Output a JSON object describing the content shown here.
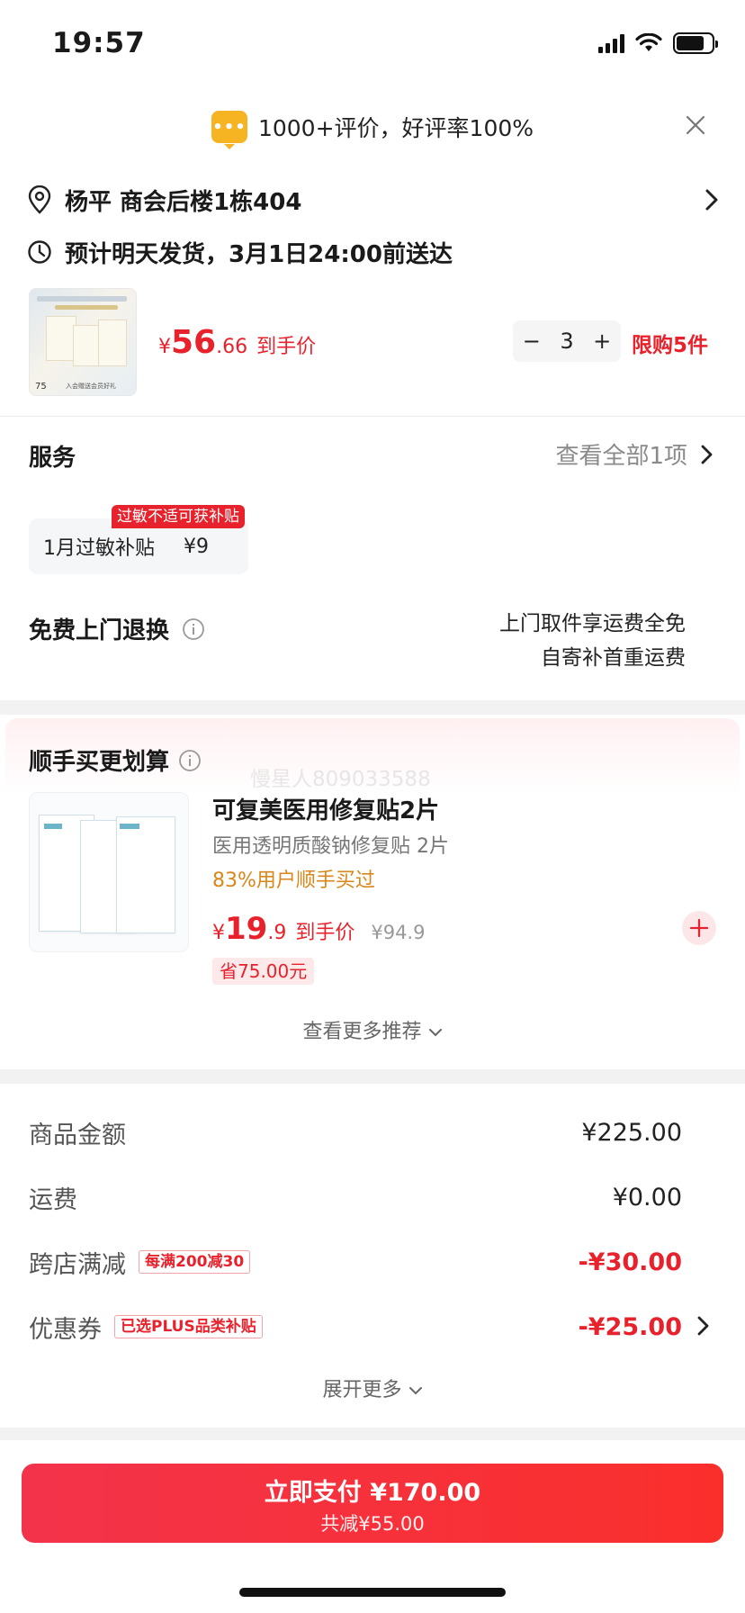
{
  "status_bar": {
    "time": "19:57"
  },
  "review_banner": {
    "icon": "message-bubble-icon",
    "icon_text": "•••",
    "text": "1000+评价，好评率100%"
  },
  "address": {
    "text": "杨平 商会后楼1栋404"
  },
  "delivery": {
    "text": "预计明天发货，3月1日24:00前送达"
  },
  "product": {
    "price_yen": "¥",
    "price_int": "56",
    "price_dec": ".66",
    "price_tag": "到手价",
    "quantity": "3",
    "minus": "−",
    "plus": "+",
    "limit": "限购5件",
    "image_label": "75",
    "image_caption": "入会赠送会员好礼"
  },
  "service": {
    "title": "服务",
    "view_all": "查看全部1项",
    "subsidy_badge": "过敏不适可获补贴",
    "subsidy_label": "1月过敏补贴",
    "subsidy_amount": "¥9",
    "return_title": "免费上门退换",
    "return_desc_line1": "上门取件享运费全免",
    "return_desc_line2": "自寄补首重运费"
  },
  "addon": {
    "title": "顺手买更划算",
    "watermark": "慢星人809033588",
    "name": "可复美医用修复贴2片",
    "desc": "医用透明质酸钠修复贴 2片",
    "pct": "83%用户顺手买过",
    "price_yen": "¥",
    "price_int": "19",
    "price_dec": ".9",
    "price_tag": "到手价",
    "orig_price": "¥94.9",
    "save": "省75.00元",
    "more": "查看更多推荐"
  },
  "amounts": {
    "goods_label": "商品金额",
    "goods_value": "¥225.00",
    "shipping_label": "运费",
    "shipping_value": "¥0.00",
    "cross_label": "跨店满减",
    "cross_chip": "每满200减30",
    "cross_value": "-¥30.00",
    "coupon_label": "优惠券",
    "coupon_chip": "已选PLUS品类补贴",
    "coupon_value": "-¥25.00",
    "expand": "展开更多"
  },
  "pay": {
    "label": "立即支付 ¥170.00",
    "sub": "共减¥55.00"
  },
  "colors": {
    "accent": "#e8222c",
    "banner_icon": "#f7b422",
    "pct_orange": "#d9861a"
  }
}
